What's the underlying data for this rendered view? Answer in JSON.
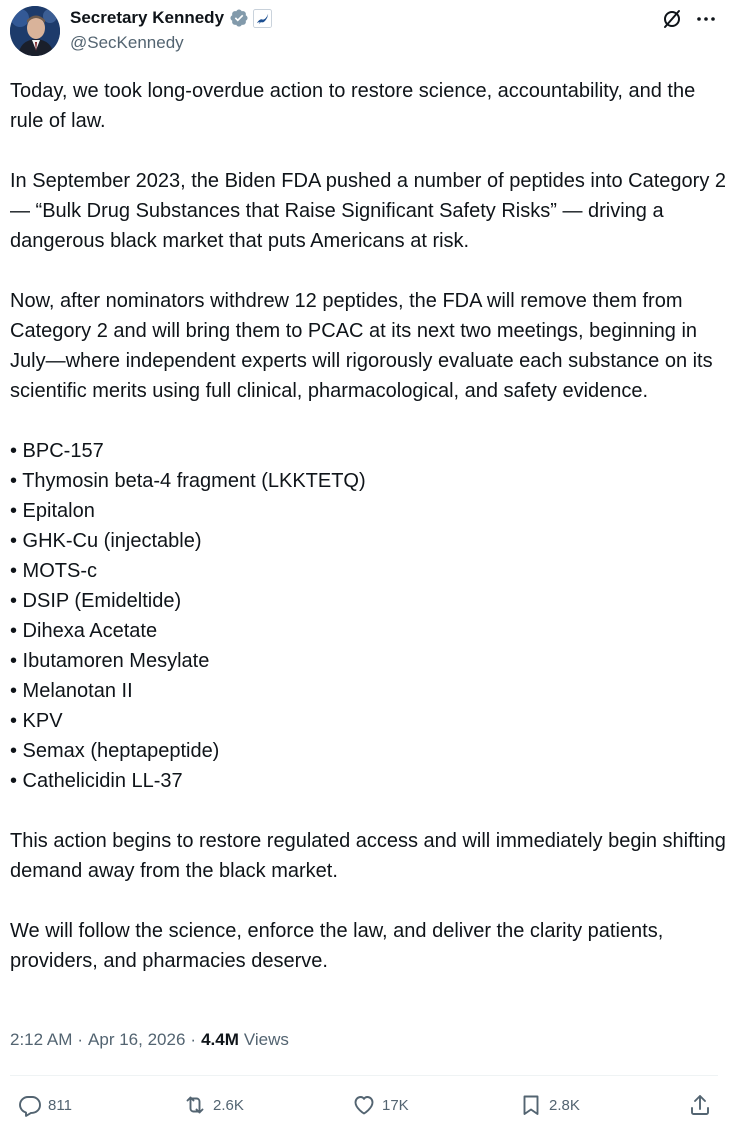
{
  "author": {
    "display_name": "Secretary Kennedy",
    "handle": "@SecKennedy",
    "verified_badge_color": "#829aab",
    "affiliation_badge_color": "#1d4f91"
  },
  "tweet": {
    "paragraphs": [
      "Today, we took long-overdue action to restore science, accountability, and the rule of law.",
      "In September 2023, the Biden FDA pushed a number of peptides into Category 2 — “Bulk Drug Substances that Raise Significant Safety Risks” — driving a dangerous black market that puts Americans at risk.",
      "Now, after nominators withdrew 12 peptides, the FDA will remove them from Category 2 and will bring them to PCAC at its next two meetings, beginning in July—where independent experts will rigorously evaluate each substance on its scientific merits using full clinical, pharmacological, and safety evidence."
    ],
    "bullets": [
      "• BPC-157",
      "• Thymosin beta-4 fragment (LKKTETQ)",
      "• Epitalon",
      "• GHK-Cu (injectable)",
      "• MOTS-c",
      "• DSIP (Emideltide)",
      "• Dihexa Acetate",
      "• Ibutamoren Mesylate",
      "• Melanotan II",
      "• KPV",
      "• Semax (heptapeptide)",
      "• Cathelicidin LL-37"
    ],
    "closing": [
      "This action begins to restore regulated access and will immediately begin shifting demand away from the black market.",
      "We will follow the science, enforce the law, and deliver the clarity patients, providers, and pharmacies deserve."
    ]
  },
  "meta": {
    "time": "2:12 AM",
    "separator": "·",
    "date": "Apr 16, 2026",
    "views_count": "4.4M",
    "views_label": "Views"
  },
  "actions": {
    "replies": "811",
    "reposts": "2.6K",
    "likes": "17K",
    "bookmarks": "2.8K"
  },
  "icons": {
    "verified": "verified-badge-icon",
    "affiliation": "hhs-affiliation-icon",
    "grok": "grok-icon",
    "more": "more-icon",
    "reply": "reply-icon",
    "repost": "repost-icon",
    "like": "like-icon",
    "bookmark": "bookmark-icon",
    "share": "share-icon"
  }
}
